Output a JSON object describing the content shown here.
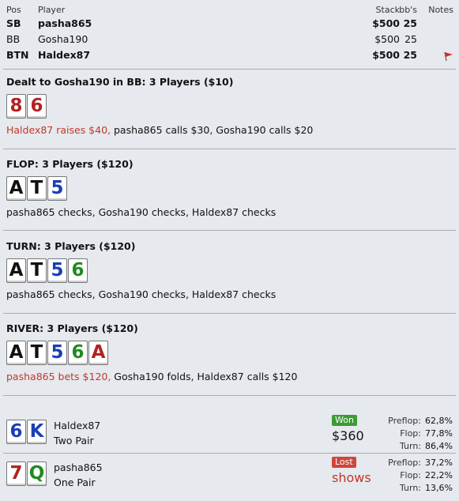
{
  "players_table": {
    "headers": {
      "pos": "Pos",
      "player": "Player",
      "stack": "Stack",
      "bbs": "bb's",
      "notes": "Notes"
    },
    "rows": [
      {
        "pos": "SB",
        "player": "pasha865",
        "stack": "$500",
        "bbs": "25",
        "bold": true
      },
      {
        "pos": "BB",
        "player": "Gosha190",
        "stack": "$500",
        "bbs": "25",
        "bold": false
      },
      {
        "pos": "BTN",
        "player": "Haldex87",
        "stack": "$500",
        "bbs": "25",
        "bold": true,
        "note_flag": "red-flag-icon"
      }
    ]
  },
  "preflop": {
    "title": "Dealt to Gosha190 in BB: 3 Players ($10)",
    "cards": [
      {
        "rank": "8",
        "suit": "h"
      },
      {
        "rank": "6",
        "suit": "h"
      }
    ],
    "action_red": "Haldex87 raises $40,",
    "action_rest": " pasha865 calls $30, Gosha190 calls $20"
  },
  "flop": {
    "title": "FLOP: 3 Players ($120)",
    "cards": [
      {
        "rank": "A",
        "suit": "s"
      },
      {
        "rank": "T",
        "suit": "s"
      },
      {
        "rank": "5",
        "suit": "d"
      }
    ],
    "action": "pasha865 checks, Gosha190 checks, Haldex87 checks"
  },
  "turn": {
    "title": "TURN: 3 Players ($120)",
    "cards": [
      {
        "rank": "A",
        "suit": "s"
      },
      {
        "rank": "T",
        "suit": "s"
      },
      {
        "rank": "5",
        "suit": "d"
      },
      {
        "rank": "6",
        "suit": "c"
      }
    ],
    "action": "pasha865 checks, Gosha190 checks, Haldex87 checks"
  },
  "river": {
    "title": "RIVER: 3 Players ($120)",
    "cards": [
      {
        "rank": "A",
        "suit": "s"
      },
      {
        "rank": "T",
        "suit": "s"
      },
      {
        "rank": "5",
        "suit": "d"
      },
      {
        "rank": "6",
        "suit": "c"
      },
      {
        "rank": "A",
        "suit": "h"
      }
    ],
    "action_red": "pasha865 bets $120,",
    "action_rest": " Gosha190 folds, Haldex87 calls $120"
  },
  "results": [
    {
      "cards": [
        {
          "rank": "6",
          "suit": "d"
        },
        {
          "rank": "K",
          "suit": "d"
        }
      ],
      "player": "Haldex87",
      "hand": "Two Pair",
      "status": "Won",
      "amount": "$360",
      "stats": [
        {
          "label": "Preflop:",
          "value": "62,8%"
        },
        {
          "label": "Flop:",
          "value": "77,8%"
        },
        {
          "label": "Turn:",
          "value": "86,4%"
        }
      ]
    },
    {
      "cards": [
        {
          "rank": "7",
          "suit": "h"
        },
        {
          "rank": "Q",
          "suit": "c"
        }
      ],
      "player": "pasha865",
      "hand": "One Pair",
      "status": "Lost",
      "amount": "shows",
      "stats": [
        {
          "label": "Preflop:",
          "value": "37,2%"
        },
        {
          "label": "Flop:",
          "value": "22,2%"
        },
        {
          "label": "Turn:",
          "value": "13,6%"
        }
      ]
    }
  ],
  "colors": {
    "hearts": "#b22222",
    "spades": "#111111",
    "diamonds": "#1a3fb5",
    "clubs": "#1f8a1f",
    "won": "#3d9b35",
    "lost": "#d0453c",
    "action_red": "#c0392b"
  }
}
